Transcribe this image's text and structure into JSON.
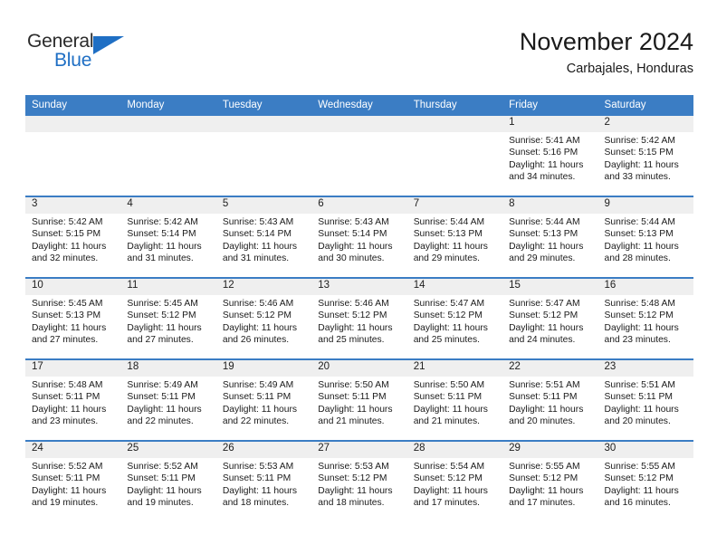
{
  "brand": {
    "name_part1": "General",
    "name_part2": "Blue",
    "triangle_icon": "triangle-icon",
    "accent_color": "#1f6fc4"
  },
  "header": {
    "month_title": "November 2024",
    "location": "Carbajales, Honduras"
  },
  "calendar": {
    "header_bg": "#3b7dc4",
    "daynum_bg": "#efefef",
    "weekday_headers": [
      "Sunday",
      "Monday",
      "Tuesday",
      "Wednesday",
      "Thursday",
      "Friday",
      "Saturday"
    ],
    "weeks": [
      [
        {
          "day": "",
          "empty": true
        },
        {
          "day": "",
          "empty": true
        },
        {
          "day": "",
          "empty": true
        },
        {
          "day": "",
          "empty": true
        },
        {
          "day": "",
          "empty": true
        },
        {
          "day": "1",
          "sunrise": "Sunrise: 5:41 AM",
          "sunset": "Sunset: 5:16 PM",
          "daylight1": "Daylight: 11 hours",
          "daylight2": "and 34 minutes."
        },
        {
          "day": "2",
          "sunrise": "Sunrise: 5:42 AM",
          "sunset": "Sunset: 5:15 PM",
          "daylight1": "Daylight: 11 hours",
          "daylight2": "and 33 minutes."
        }
      ],
      [
        {
          "day": "3",
          "sunrise": "Sunrise: 5:42 AM",
          "sunset": "Sunset: 5:15 PM",
          "daylight1": "Daylight: 11 hours",
          "daylight2": "and 32 minutes."
        },
        {
          "day": "4",
          "sunrise": "Sunrise: 5:42 AM",
          "sunset": "Sunset: 5:14 PM",
          "daylight1": "Daylight: 11 hours",
          "daylight2": "and 31 minutes."
        },
        {
          "day": "5",
          "sunrise": "Sunrise: 5:43 AM",
          "sunset": "Sunset: 5:14 PM",
          "daylight1": "Daylight: 11 hours",
          "daylight2": "and 31 minutes."
        },
        {
          "day": "6",
          "sunrise": "Sunrise: 5:43 AM",
          "sunset": "Sunset: 5:14 PM",
          "daylight1": "Daylight: 11 hours",
          "daylight2": "and 30 minutes."
        },
        {
          "day": "7",
          "sunrise": "Sunrise: 5:44 AM",
          "sunset": "Sunset: 5:13 PM",
          "daylight1": "Daylight: 11 hours",
          "daylight2": "and 29 minutes."
        },
        {
          "day": "8",
          "sunrise": "Sunrise: 5:44 AM",
          "sunset": "Sunset: 5:13 PM",
          "daylight1": "Daylight: 11 hours",
          "daylight2": "and 29 minutes."
        },
        {
          "day": "9",
          "sunrise": "Sunrise: 5:44 AM",
          "sunset": "Sunset: 5:13 PM",
          "daylight1": "Daylight: 11 hours",
          "daylight2": "and 28 minutes."
        }
      ],
      [
        {
          "day": "10",
          "sunrise": "Sunrise: 5:45 AM",
          "sunset": "Sunset: 5:13 PM",
          "daylight1": "Daylight: 11 hours",
          "daylight2": "and 27 minutes."
        },
        {
          "day": "11",
          "sunrise": "Sunrise: 5:45 AM",
          "sunset": "Sunset: 5:12 PM",
          "daylight1": "Daylight: 11 hours",
          "daylight2": "and 27 minutes."
        },
        {
          "day": "12",
          "sunrise": "Sunrise: 5:46 AM",
          "sunset": "Sunset: 5:12 PM",
          "daylight1": "Daylight: 11 hours",
          "daylight2": "and 26 minutes."
        },
        {
          "day": "13",
          "sunrise": "Sunrise: 5:46 AM",
          "sunset": "Sunset: 5:12 PM",
          "daylight1": "Daylight: 11 hours",
          "daylight2": "and 25 minutes."
        },
        {
          "day": "14",
          "sunrise": "Sunrise: 5:47 AM",
          "sunset": "Sunset: 5:12 PM",
          "daylight1": "Daylight: 11 hours",
          "daylight2": "and 25 minutes."
        },
        {
          "day": "15",
          "sunrise": "Sunrise: 5:47 AM",
          "sunset": "Sunset: 5:12 PM",
          "daylight1": "Daylight: 11 hours",
          "daylight2": "and 24 minutes."
        },
        {
          "day": "16",
          "sunrise": "Sunrise: 5:48 AM",
          "sunset": "Sunset: 5:12 PM",
          "daylight1": "Daylight: 11 hours",
          "daylight2": "and 23 minutes."
        }
      ],
      [
        {
          "day": "17",
          "sunrise": "Sunrise: 5:48 AM",
          "sunset": "Sunset: 5:11 PM",
          "daylight1": "Daylight: 11 hours",
          "daylight2": "and 23 minutes."
        },
        {
          "day": "18",
          "sunrise": "Sunrise: 5:49 AM",
          "sunset": "Sunset: 5:11 PM",
          "daylight1": "Daylight: 11 hours",
          "daylight2": "and 22 minutes."
        },
        {
          "day": "19",
          "sunrise": "Sunrise: 5:49 AM",
          "sunset": "Sunset: 5:11 PM",
          "daylight1": "Daylight: 11 hours",
          "daylight2": "and 22 minutes."
        },
        {
          "day": "20",
          "sunrise": "Sunrise: 5:50 AM",
          "sunset": "Sunset: 5:11 PM",
          "daylight1": "Daylight: 11 hours",
          "daylight2": "and 21 minutes."
        },
        {
          "day": "21",
          "sunrise": "Sunrise: 5:50 AM",
          "sunset": "Sunset: 5:11 PM",
          "daylight1": "Daylight: 11 hours",
          "daylight2": "and 21 minutes."
        },
        {
          "day": "22",
          "sunrise": "Sunrise: 5:51 AM",
          "sunset": "Sunset: 5:11 PM",
          "daylight1": "Daylight: 11 hours",
          "daylight2": "and 20 minutes."
        },
        {
          "day": "23",
          "sunrise": "Sunrise: 5:51 AM",
          "sunset": "Sunset: 5:11 PM",
          "daylight1": "Daylight: 11 hours",
          "daylight2": "and 20 minutes."
        }
      ],
      [
        {
          "day": "24",
          "sunrise": "Sunrise: 5:52 AM",
          "sunset": "Sunset: 5:11 PM",
          "daylight1": "Daylight: 11 hours",
          "daylight2": "and 19 minutes."
        },
        {
          "day": "25",
          "sunrise": "Sunrise: 5:52 AM",
          "sunset": "Sunset: 5:11 PM",
          "daylight1": "Daylight: 11 hours",
          "daylight2": "and 19 minutes."
        },
        {
          "day": "26",
          "sunrise": "Sunrise: 5:53 AM",
          "sunset": "Sunset: 5:11 PM",
          "daylight1": "Daylight: 11 hours",
          "daylight2": "and 18 minutes."
        },
        {
          "day": "27",
          "sunrise": "Sunrise: 5:53 AM",
          "sunset": "Sunset: 5:12 PM",
          "daylight1": "Daylight: 11 hours",
          "daylight2": "and 18 minutes."
        },
        {
          "day": "28",
          "sunrise": "Sunrise: 5:54 AM",
          "sunset": "Sunset: 5:12 PM",
          "daylight1": "Daylight: 11 hours",
          "daylight2": "and 17 minutes."
        },
        {
          "day": "29",
          "sunrise": "Sunrise: 5:55 AM",
          "sunset": "Sunset: 5:12 PM",
          "daylight1": "Daylight: 11 hours",
          "daylight2": "and 17 minutes."
        },
        {
          "day": "30",
          "sunrise": "Sunrise: 5:55 AM",
          "sunset": "Sunset: 5:12 PM",
          "daylight1": "Daylight: 11 hours",
          "daylight2": "and 16 minutes."
        }
      ]
    ]
  }
}
